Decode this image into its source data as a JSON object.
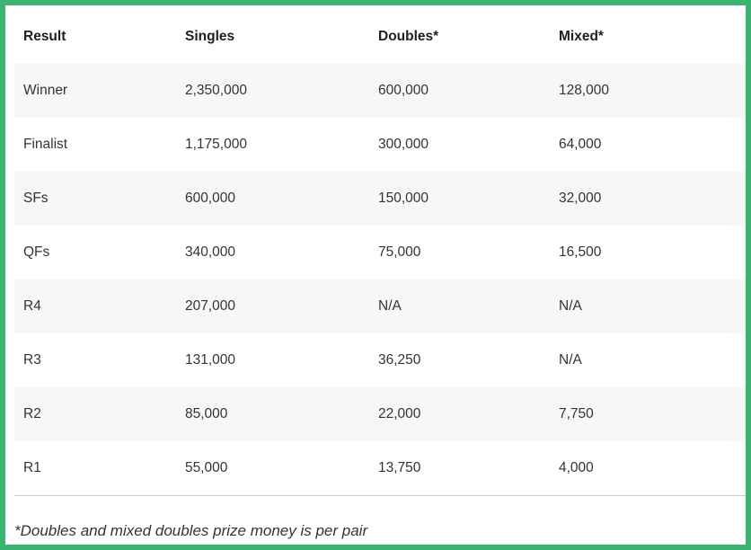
{
  "table": {
    "headers": [
      "Result",
      "Singles",
      "Doubles*",
      "Mixed*"
    ],
    "rows": [
      [
        "Winner",
        "2,350,000",
        "600,000",
        "128,000"
      ],
      [
        "Finalist",
        "1,175,000",
        "300,000",
        "64,000"
      ],
      [
        "SFs",
        "600,000",
        "150,000",
        "32,000"
      ],
      [
        "QFs",
        "340,000",
        "75,000",
        "16,500"
      ],
      [
        "R4",
        "207,000",
        "N/A",
        "N/A"
      ],
      [
        "R3",
        "131,000",
        "36,250",
        "N/A"
      ],
      [
        "R2",
        "85,000",
        "22,000",
        "7,750"
      ],
      [
        "R1",
        "55,000",
        "13,750",
        "4,000"
      ]
    ]
  },
  "footnote": "*Doubles and mixed doubles prize money is per pair",
  "colors": {
    "frame_border": "#3cb371",
    "stripe_row": "#f7f7f7"
  }
}
